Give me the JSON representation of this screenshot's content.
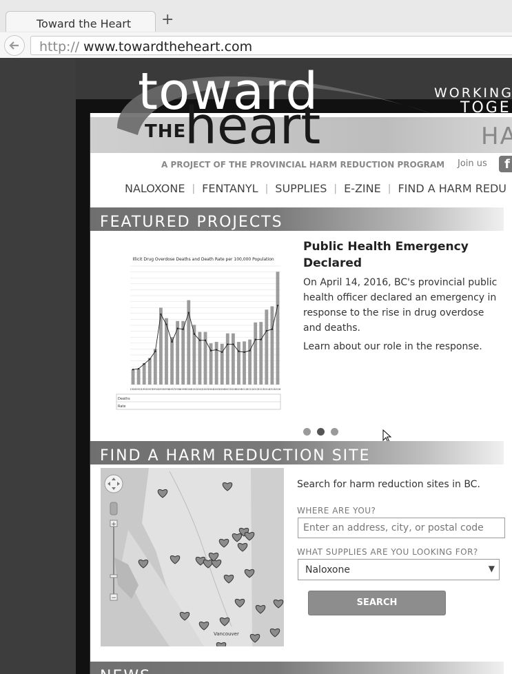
{
  "browser": {
    "tab_title": "Toward the Heart",
    "new_tab": "+",
    "url_scheme": "http://",
    "url_host": "www.towardtheheart.com"
  },
  "header": {
    "logo_toward": "toward",
    "logo_the": "THE",
    "logo_heart": "heart",
    "tagline_1": "WORKING",
    "tagline_2": "TOGE",
    "header_right": "HA",
    "project_line": "A PROJECT OF THE PROVINCIAL HARM REDUCTION PROGRAM",
    "join_us": "Join us",
    "fb": "f"
  },
  "nav": {
    "items": [
      "NALOXONE",
      "FENTANYL",
      "SUPPLIES",
      "E-ZINE",
      "FIND A HARM REDU"
    ]
  },
  "featured": {
    "section_title": "FEATURED PROJECTS",
    "title": "Public Health Emergency Declared",
    "body": "On April 14, 2016, BC's provincial public health officer declared an emergency in response to the rise in drug overdose and deaths.",
    "learn": "Learn about our role in the response.",
    "slide_count": 3,
    "active_slide": 2
  },
  "chart_data": {
    "type": "bar",
    "title": "Illicit Drug Overdose Deaths and Death Rate per 100,000 Population",
    "categories": [
      "1990",
      "1991",
      "1992",
      "1993",
      "1994",
      "1995",
      "1996",
      "1997",
      "1998",
      "1999",
      "2000",
      "2001",
      "2002",
      "2003",
      "2004",
      "2005",
      "2006",
      "2007",
      "2008",
      "2009",
      "2010",
      "2011",
      "2012",
      "2013",
      "2014",
      "2015",
      "2016"
    ],
    "series": [
      {
        "name": "Deaths",
        "values": [
          64,
          66,
          90,
          112,
          150,
          324,
          280,
          200,
          268,
          268,
          356,
          252,
          222,
          222,
          174,
          180,
          172,
          216,
          216,
          180,
          182,
          190,
          262,
          264,
          316,
          330,
          476
        ]
      },
      {
        "name": "Rate",
        "values": [
          1.9,
          2.0,
          2.6,
          3.2,
          4.2,
          8.9,
          7.6,
          5.4,
          7.1,
          7.0,
          9.1,
          6.4,
          5.6,
          5.6,
          4.3,
          4.4,
          4.1,
          5.1,
          5.1,
          4.2,
          4.1,
          4.3,
          5.7,
          5.7,
          6.8,
          7.0,
          10.0
        ]
      }
    ],
    "ylim": [
      0,
      500
    ]
  },
  "find_site": {
    "section_title": "FIND A HARM REDUCTION SITE",
    "intro": "Search for harm reduction sites in BC.",
    "where_label": "WHERE ARE YOU?",
    "where_placeholder": "Enter an address, city, or postal code",
    "supplies_label": "WHAT SUPPLIES ARE YOU LOOKING FOR?",
    "supplies_value": "Naloxone",
    "search_label": "SEARCH",
    "map_city": "Vancouver",
    "zoom_in": "+",
    "zoom_out": "−"
  },
  "news": {
    "section_title": "NEWS"
  }
}
